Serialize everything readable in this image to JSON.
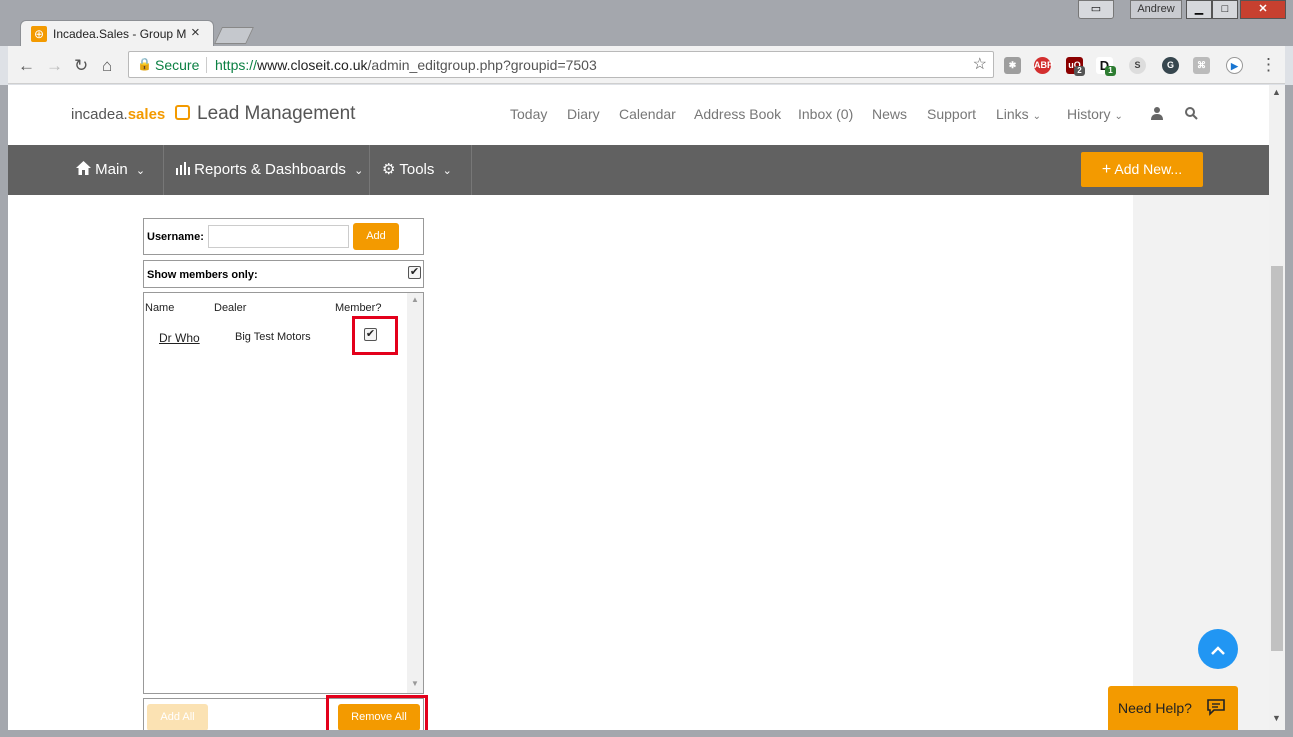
{
  "browser": {
    "tab_title": "Incadea.Sales - Group M",
    "tab_close": "×",
    "user_name": "Andrew",
    "secure_label": "Secure",
    "url_protocol": "https://",
    "url_host": "www.closeit.co.uk",
    "url_path": "/admin_editgroup.php?groupid=7503",
    "extensions": [
      "ABP",
      "uO",
      "D",
      "S",
      "G"
    ],
    "ext_badges": [
      "2",
      "1"
    ]
  },
  "header": {
    "logo_prefix": "incadea.",
    "logo_accent": "sales",
    "app_title": "Lead Management",
    "links": [
      "Today",
      "Diary",
      "Calendar",
      "Address Book",
      "Inbox (0)",
      "News",
      "Support",
      "Links",
      "History"
    ]
  },
  "mainbar": {
    "main": "Main",
    "reports": "Reports & Dashboards",
    "tools": "Tools",
    "add_new": "Add New..."
  },
  "form": {
    "username_label": "Username:",
    "username_value": "",
    "add_button": "Add",
    "show_members_label": "Show members only:",
    "show_members_checked": true
  },
  "members_table": {
    "columns": [
      "Name",
      "Dealer",
      "Member?"
    ],
    "rows": [
      {
        "name": "Dr Who",
        "dealer": "Big Test Motors",
        "member": true
      }
    ]
  },
  "buttons": {
    "add_all": "Add All",
    "remove_all": "Remove All"
  },
  "help": {
    "label": "Need Help?"
  },
  "colors": {
    "accent": "#f39a00",
    "mainbar": "#616161",
    "highlight": "#e3001b",
    "fab": "#2196f3"
  }
}
